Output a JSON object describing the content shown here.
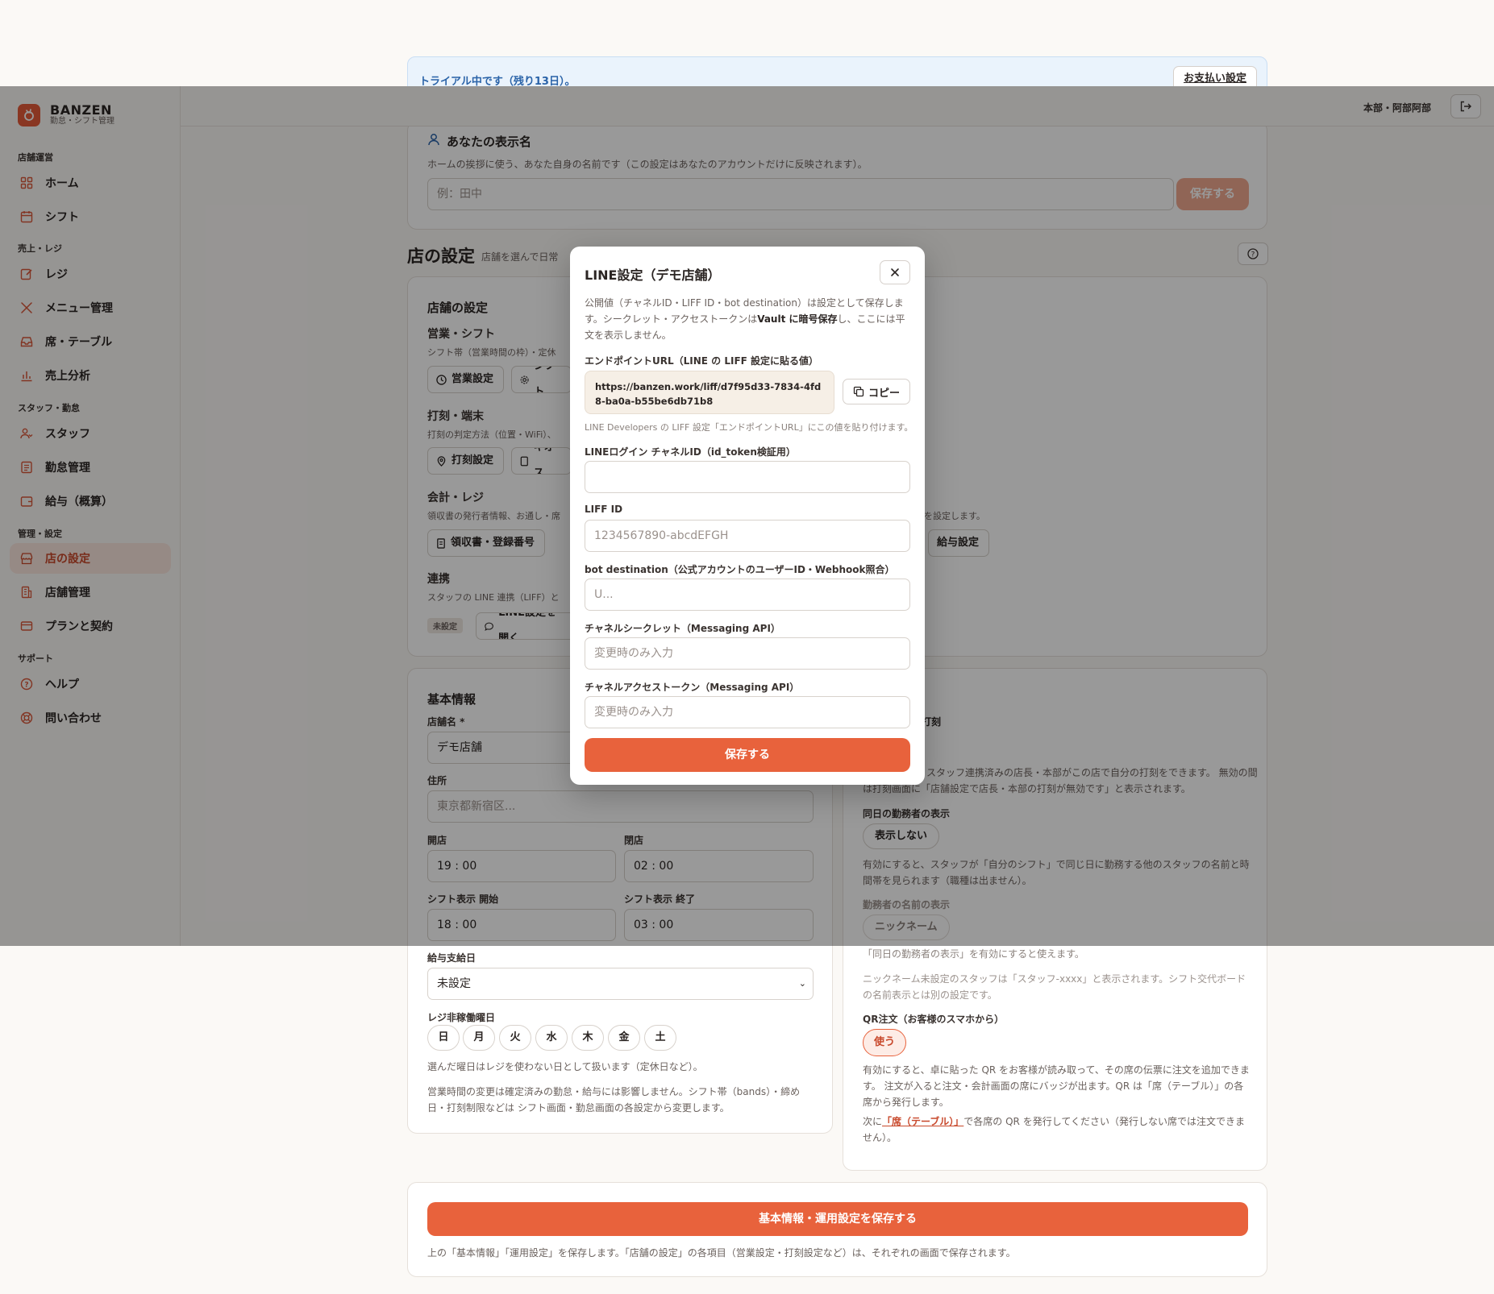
{
  "trial": {
    "message": "トライアル中です（残り13日）。",
    "billing_button": "お支払い設定"
  },
  "header": {
    "user": "本部・阿部阿部"
  },
  "brand": {
    "name": "BANZEN",
    "subtitle": "勤怠・シフト管理"
  },
  "sidebar": {
    "sections": {
      "store_ops": "店舗運営",
      "sales": "売上・レジ",
      "staff": "スタッフ・勤怠",
      "admin": "管理・設定",
      "support": "サポート"
    },
    "items": {
      "home": "ホーム",
      "shift": "シフト",
      "register": "レジ",
      "menu": "メニュー管理",
      "tables": "席・テーブル",
      "analytics": "売上分析",
      "staff": "スタッフ",
      "attendance": "勤怠管理",
      "payroll": "給与（概算）",
      "store_settings": "店の設定",
      "store_mgmt": "店舗管理",
      "plan": "プランと契約",
      "help": "ヘルプ",
      "contact": "問い合わせ"
    }
  },
  "display_name": {
    "title": "あなたの表示名",
    "hint": "ホームの挨拶に使う、あなた自身の名前です（この設定はあなたのアカウントだけに反映されます）。",
    "placeholder": "例：田中",
    "save": "保存する"
  },
  "store_settings": {
    "heading": "店の設定",
    "heading_sub": "店舗を選んで日常",
    "card_title": "店舗の設定",
    "business": {
      "title": "営業・シフト",
      "hint": "シフト帯（営業時間の枠）・定休",
      "btn1": "営業設定",
      "btn2": "シフト"
    },
    "punch": {
      "title": "打刻・端末",
      "hint": "打刻の判定方法（位置・WiFi）、",
      "btn1": "打刻設定",
      "btn2": "キオス"
    },
    "accounting": {
      "title": "会計・レジ",
      "hint": "領収書の発行者情報、お通し・席",
      "hint_right": "を設定します。",
      "btn1": "領収書・登録番号",
      "btn_right": "給与設定"
    },
    "integration": {
      "title": "連携",
      "hint": "スタッフの LINE 連携（LIFF）と",
      "badge": "未設定",
      "btn": "LINE設定を開く"
    }
  },
  "basic_info": {
    "title": "基本情報",
    "store_name_label": "店舗名 *",
    "store_name": "デモ店舗",
    "address_label": "住所",
    "address_placeholder": "東京都新宿区...",
    "open_label": "開店",
    "open": "19 : 00",
    "close_label": "閉店",
    "close": "02 : 00",
    "shift_start_label": "シフト表示 開始",
    "shift_start": "18 : 00",
    "shift_end_label": "シフト表示 終了",
    "shift_end": "03 : 00",
    "payday_label": "給与支給日",
    "payday": "未設定",
    "closed_days_label": "レジ非稼働曜日",
    "days": [
      "日",
      "月",
      "火",
      "水",
      "木",
      "金",
      "土"
    ],
    "closed_days_hint": "選んだ曜日はレジを使わない日として扱います（定休日など）。",
    "note": "営業時間の変更は確定済みの勤怠・給与には影響しません。シフト帯（bands）・締め日・打刻制限などは シフト画面・勤怠画面の各設定から変更します。"
  },
  "ops": {
    "punch_suffix": "打刻",
    "punch_desc_1": "スタッフ連携済みの店長・本部がこの店で自分の打刻をできます。 無効の間",
    "punch_desc_2": "は打刻画面に「店舗設定で店長・本部の打刻が無効です」と表示されます。",
    "same_day_label": "同日の勤務者の表示",
    "same_day_value": "表示しない",
    "same_day_desc": "有効にすると、スタッフが「自分のシフト」で同じ日に勤務する他のスタッフの名前と時間帯を見られます（職種は出ません）。",
    "name_label": "勤務者の名前の表示",
    "name_value": "ニックネーム",
    "name_hint1": "「同日の勤務者の表示」を有効にすると使えます。",
    "name_hint2": "ニックネーム未設定のスタッフは「スタッフ-xxxx」と表示されます。シフト交代ボードの名前表示とは別の設定です。",
    "qr_label": "QR注文（お客様のスマホから）",
    "qr_value": "使う",
    "qr_desc": "有効にすると、卓に貼った QR をお客様が読み取って、その席の伝票に注文を追加できます。 注文が入ると注文・会計画面の席にバッジが出ます。QR は「席（テーブル）」の各席から発行します。",
    "qr_next_pre": "次に",
    "qr_next_link": "「席（テーブル）」",
    "qr_next_post": "で各席の QR を発行してください（発行しない席では注文できません）。"
  },
  "footer": {
    "save": "基本情報・運用設定を保存する",
    "note": "上の「基本情報」「運用設定」を保存します。「店舗の設定」の各項目（営業設定・打刻設定など）は、それぞれの画面で保存されます。"
  },
  "modal": {
    "title": "LINE設定（デモ店舗）",
    "desc_1": "公開値（チャネルID・LIFF ID・bot destination）は設定として保存します。シークレット・アクセストークンは",
    "desc_bold": "Vault に暗号保存",
    "desc_2": "し、ここには平文を表示しません。",
    "endpoint_label": "エンドポイントURL（LINE の LIFF 設定に貼る値）",
    "endpoint_url": "https://banzen.work/liff/d7f95d33-7834-4fd8-ba0a-b55be6db71b8",
    "copy": "コピー",
    "endpoint_hint": "LINE Developers の LIFF 設定「エンドポイントURL」にこの値を貼り付けます。",
    "channel_id_label": "LINEログイン チャネルID（id_token検証用）",
    "channel_id_value": "",
    "liff_label": "LIFF ID",
    "liff_placeholder": "1234567890-abcdEFGH",
    "bot_label": "bot destination（公式アカウントのユーザーID・Webhook照合）",
    "bot_placeholder": "U...",
    "secret_label": "チャネルシークレット（Messaging API）",
    "secret_placeholder": "変更時のみ入力",
    "token_label": "チャネルアクセストークン（Messaging API）",
    "token_placeholder": "変更時のみ入力",
    "save": "保存する"
  },
  "colors": {
    "accent": "#e8623c",
    "active_bg": "#fbe7de",
    "trial_bg": "#eaf3fc"
  }
}
